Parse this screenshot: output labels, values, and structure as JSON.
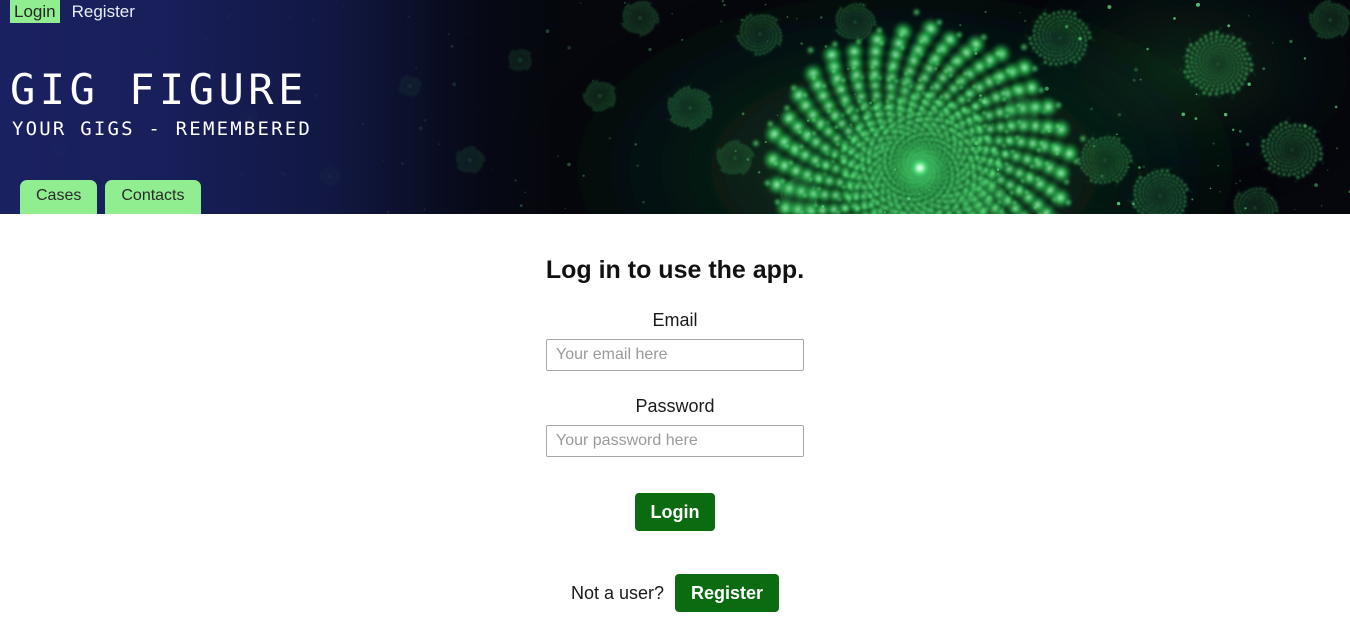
{
  "topnav": {
    "items": [
      {
        "label": "Login",
        "active": true
      },
      {
        "label": "Register",
        "active": false
      }
    ]
  },
  "hero": {
    "title": "GIG FIGURE",
    "tagline": "YOUR GIGS - REMEMBERED",
    "background_description": "green-mandelbrot-spiral-fractal-on-black",
    "colors": {
      "navy_overlay": "#1b2263",
      "fractal_green": "#2fcf5a",
      "fractal_black": "#05070d"
    }
  },
  "tabs": [
    {
      "label": "Cases"
    },
    {
      "label": "Contacts"
    }
  ],
  "main": {
    "heading": "Log in to use the app.",
    "email": {
      "label": "Email",
      "placeholder": "Your email here",
      "value": ""
    },
    "password": {
      "label": "Password",
      "placeholder": "Your password here",
      "value": ""
    },
    "login_button": "Login",
    "register_prompt": "Not a user?",
    "register_button": "Register"
  },
  "colors": {
    "accent_light_green": "#90ee90",
    "accent_dark_green": "#0b6b10",
    "text_dark": "#111111",
    "input_border": "#a8a8a8",
    "placeholder": "#9a9a9a"
  }
}
